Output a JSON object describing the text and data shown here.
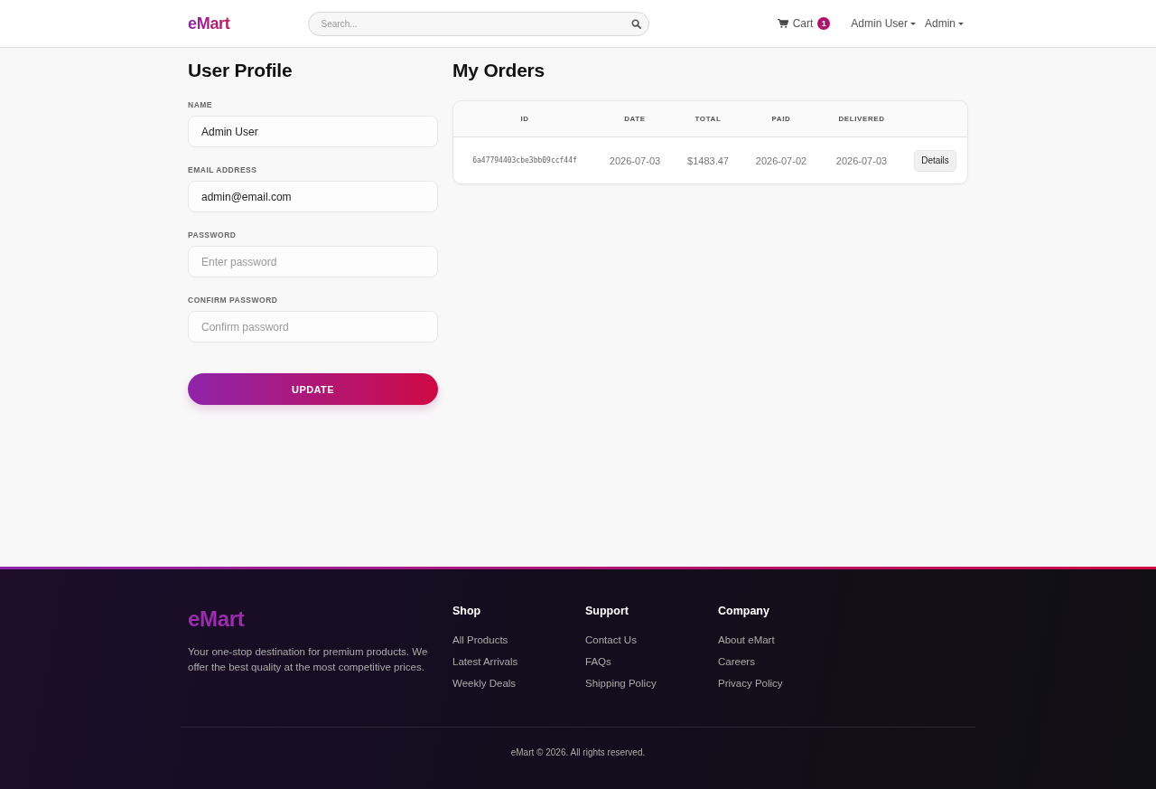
{
  "navbar": {
    "logo": "eMart",
    "search": {
      "placeholder": "Search..."
    },
    "cart": {
      "label": "Cart",
      "count": "1"
    },
    "menus": [
      {
        "label": "Admin User"
      },
      {
        "label": "Admin"
      }
    ]
  },
  "profile": {
    "title": "User Profile",
    "fields": [
      {
        "label": "NAME",
        "value": "Admin User"
      },
      {
        "label": "EMAIL ADDRESS",
        "value": "admin@email.com"
      },
      {
        "label": "PASSWORD",
        "placeholder": "Enter password"
      },
      {
        "label": "CONFIRM PASSWORD",
        "placeholder": "Confirm password"
      }
    ],
    "submit": "UPDATE"
  },
  "orders": {
    "title": "My Orders",
    "table": {
      "columns": [
        "ID",
        "DATE",
        "TOTAL",
        "PAID",
        "DELIVERED"
      ],
      "rows": [
        {
          "id": "6a47794403cbe3bb09ccf44f",
          "date": "2026-07-03",
          "total": "$1483.47",
          "paid": "2026-07-02",
          "delivered": "2026-07-03",
          "action": "Details"
        }
      ]
    }
  },
  "footer": {
    "logo": "eMart",
    "tagline": "Your one-stop destination for premium products. We offer the best quality at the most competitive prices.",
    "columns": [
      {
        "title": "Shop",
        "links": [
          "All Products",
          "Latest Arrivals",
          "Weekly Deals"
        ]
      },
      {
        "title": "Support",
        "links": [
          "Contact Us",
          "FAQs",
          "Shipping Policy"
        ]
      },
      {
        "title": "Company",
        "links": [
          "About eMart",
          "Careers",
          "Privacy Policy"
        ]
      }
    ],
    "copyright": "eMart © 2026. All rights reserved."
  }
}
